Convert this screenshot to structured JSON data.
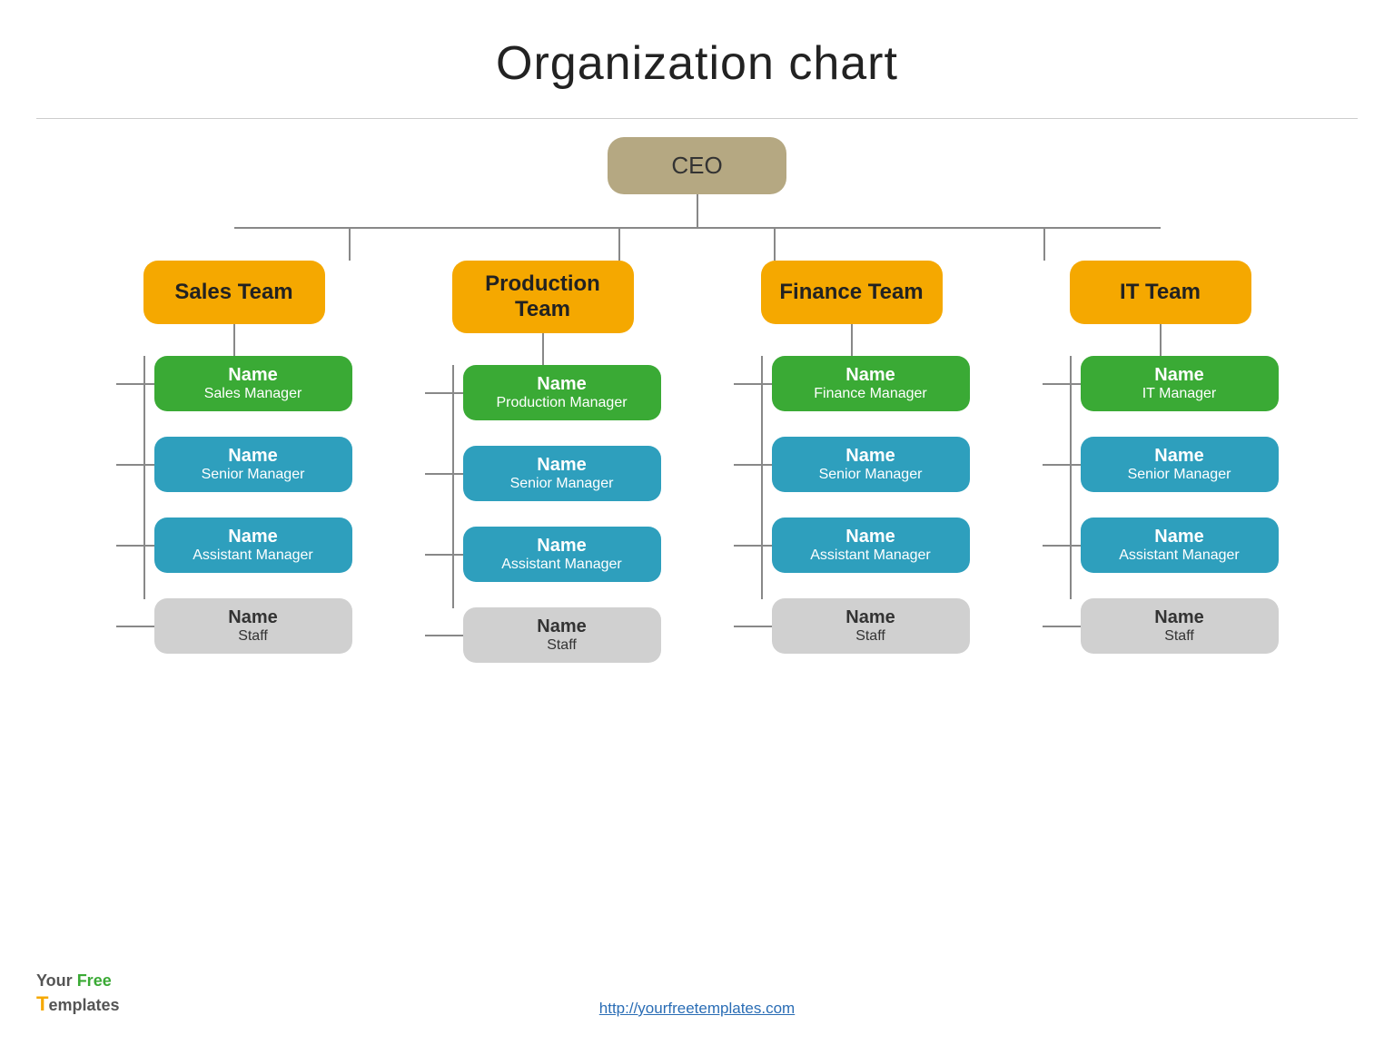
{
  "title": "Organization chart",
  "ceo": {
    "label": "CEO"
  },
  "teams": [
    {
      "id": "sales",
      "name": "Sales Team",
      "manager": {
        "name": "Name",
        "role": "Sales Manager"
      },
      "senior": {
        "name": "Name",
        "role": "Senior Manager"
      },
      "assistant": {
        "name": "Name",
        "role": "Assistant Manager"
      },
      "staff": {
        "name": "Name",
        "role": "Staff"
      }
    },
    {
      "id": "production",
      "name": "Production\nTeam",
      "manager": {
        "name": "Name",
        "role": "Production Manager"
      },
      "senior": {
        "name": "Name",
        "role": "Senior Manager"
      },
      "assistant": {
        "name": "Name",
        "role": "Assistant Manager"
      },
      "staff": {
        "name": "Name",
        "role": "Staff"
      }
    },
    {
      "id": "finance",
      "name": "Finance Team",
      "manager": {
        "name": "Name",
        "role": "Finance Manager"
      },
      "senior": {
        "name": "Name",
        "role": "Senior Manager"
      },
      "assistant": {
        "name": "Name",
        "role": "Assistant Manager"
      },
      "staff": {
        "name": "Name",
        "role": "Staff"
      }
    },
    {
      "id": "it",
      "name": "IT Team",
      "manager": {
        "name": "Name",
        "role": "IT Manager"
      },
      "senior": {
        "name": "Name",
        "role": "Senior Manager"
      },
      "assistant": {
        "name": "Name",
        "role": "Assistant Manager"
      },
      "staff": {
        "name": "Name",
        "role": "Staff"
      }
    }
  ],
  "footer": {
    "logo_your": "Your",
    "logo_free": "Free",
    "logo_templates": "Templates",
    "link": "http://yourfreetemplates.com"
  }
}
